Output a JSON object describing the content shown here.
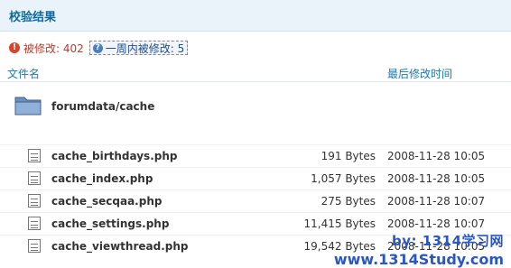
{
  "header": {
    "title": "校验结果"
  },
  "summary": {
    "modified_label": "被修改: 402",
    "week_label": "一周内被修改: 5"
  },
  "columns": {
    "name": "文件名",
    "modified_time": "最后修改时间"
  },
  "folder": {
    "name": "forumdata/cache"
  },
  "files": [
    {
      "name": "cache_birthdays.php",
      "size": "191 Bytes",
      "time": "2008-11-28 10:05"
    },
    {
      "name": "cache_index.php",
      "size": "1,057 Bytes",
      "time": "2008-11-28 10:05"
    },
    {
      "name": "cache_secqaa.php",
      "size": "275 Bytes",
      "time": "2008-11-28 10:07"
    },
    {
      "name": "cache_settings.php",
      "size": "11,415 Bytes",
      "time": "2008-11-28 10:07"
    },
    {
      "name": "cache_viewthread.php",
      "size": "19,542 Bytes",
      "time": "2008-11-28 10:05"
    }
  ],
  "watermark": {
    "line1": "by: 1314学习网",
    "line2": "www.1314Study.com"
  },
  "colors": {
    "header_bg": "#eaf3f9",
    "title": "#0b6a9e",
    "warn": "#c0392b",
    "link": "#1a7ab3"
  }
}
